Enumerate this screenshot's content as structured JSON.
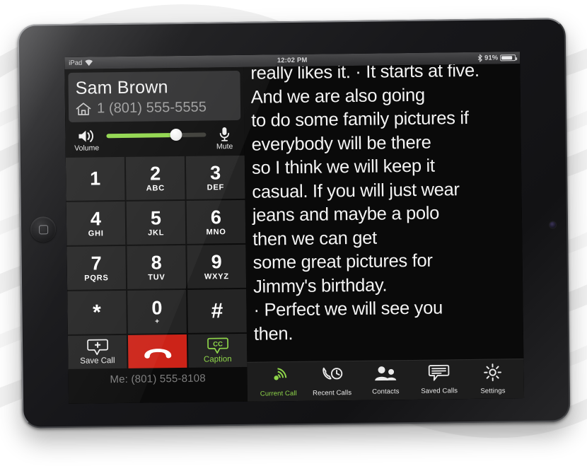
{
  "device": {
    "name": "iPad",
    "home_button": "home-button",
    "camera": "front-camera"
  },
  "status_bar": {
    "carrier": "iPad",
    "wifi_icon": "wifi-icon",
    "time": "12:02 PM",
    "bluetooth_icon": "bluetooth-icon",
    "battery_percent": "91%",
    "battery_icon": "battery-icon",
    "battery_level": 91
  },
  "contact": {
    "name": "Sam Brown",
    "number": "1 (801) 555-5555",
    "location_icon": "home-icon"
  },
  "volume": {
    "label": "Volume",
    "speaker_icon": "speaker-icon",
    "level": 70
  },
  "mute": {
    "label": "Mute",
    "icon": "microphone-icon"
  },
  "keypad": [
    {
      "digit": "1",
      "letters": ""
    },
    {
      "digit": "2",
      "letters": "ABC"
    },
    {
      "digit": "3",
      "letters": "DEF"
    },
    {
      "digit": "4",
      "letters": "GHI"
    },
    {
      "digit": "5",
      "letters": "JKL"
    },
    {
      "digit": "6",
      "letters": "MNO"
    },
    {
      "digit": "7",
      "letters": "PQRS"
    },
    {
      "digit": "8",
      "letters": "TUV"
    },
    {
      "digit": "9",
      "letters": "WXYZ"
    },
    {
      "digit": "*",
      "letters": ""
    },
    {
      "digit": "0",
      "letters": "+"
    },
    {
      "digit": "#",
      "letters": ""
    }
  ],
  "actions": {
    "save_call_label": "Save Call",
    "save_call_icon": "speech-bubble-plus-icon",
    "end_call_icon": "end-call-handset-icon",
    "caption_label": "Caption",
    "caption_icon": "cc-bubble-icon"
  },
  "me_line": "Me: (801) 555-8108",
  "caption": {
    "lines": [
      "really likes it.  · It starts at five.",
      "And we are also going",
      "to do some family pictures if",
      "everybody will be there",
      "so I think we will keep it",
      "casual. If you will just wear",
      "jeans and maybe a polo",
      "then we can get",
      "some great pictures  for",
      "Jimmy's birthday.",
      " · Perfect we will see you",
      "then."
    ]
  },
  "tabs": [
    {
      "label": "Current Call",
      "icon": "current-call-icon",
      "active": true
    },
    {
      "label": "Recent Calls",
      "icon": "recent-calls-icon",
      "active": false
    },
    {
      "label": "Contacts",
      "icon": "contacts-icon",
      "active": false
    },
    {
      "label": "Saved Calls",
      "icon": "saved-calls-icon",
      "active": false
    },
    {
      "label": "Settings",
      "icon": "settings-gear-icon",
      "active": false
    }
  ],
  "colors": {
    "accent_green": "#8fd64a",
    "end_call_red": "#cc2318",
    "panel_dark": "#242424",
    "screen_black": "#0a0a0a"
  }
}
